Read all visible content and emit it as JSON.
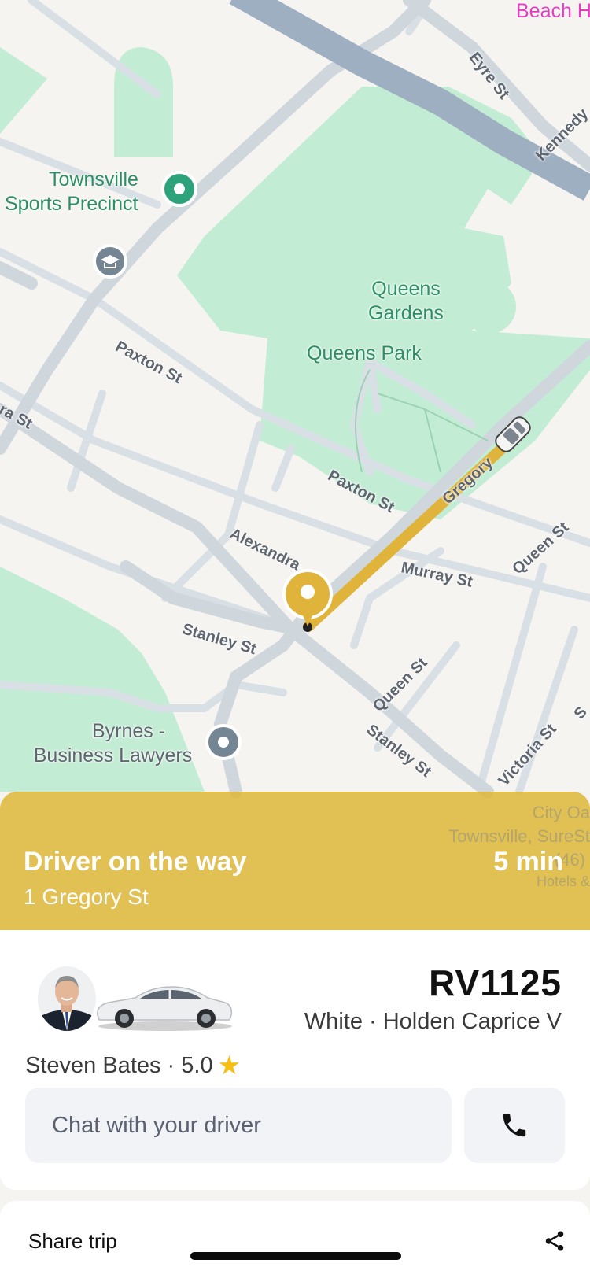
{
  "map": {
    "streets": {
      "eyre": "Eyre St",
      "kennedy": "Kennedy",
      "paxton_1": "Paxton St",
      "paxton_2": "Paxton St",
      "ra_st": "ra St",
      "alexandra": "Alexandra",
      "gregory": "Gregory",
      "murray": "Murray St",
      "queen_1": "Queen St",
      "queen_2": "Queen St",
      "stanley_1": "Stanley St",
      "stanley_2": "Stanley St",
      "victoria": "Victoria St",
      "s_edge": "S"
    },
    "pois": {
      "townsville_sports_line1": "Townsville",
      "townsville_sports_line2": "Sports Precinct",
      "queens_gardens_line1": "Queens",
      "queens_gardens_line2": "Gardens",
      "queens_park": "Queens Park",
      "byrnes_line1": "Byrnes -",
      "byrnes_line2": "Business Lawyers",
      "beach": "Beach H",
      "city_oaks_line1": "City Oa",
      "city_oaks_line2": "Townsville, SureSt",
      "city_oaks_line3": "(46)",
      "city_oaks_line4": "Hotels &"
    }
  },
  "status": {
    "title": "Driver on the way",
    "address": "1 Gregory St",
    "eta": "5 min"
  },
  "driver": {
    "plate": "RV1125",
    "vehicle": "White · Holden Caprice V",
    "name": "Steven Bates",
    "rating": "5.0",
    "name_rating": "Steven Bates · 5.0"
  },
  "chat": {
    "placeholder": "Chat with your driver"
  },
  "share": {
    "label": "Share trip"
  },
  "colors": {
    "accent": "#DEB83E",
    "route": "#E0B43A",
    "park": "#C3ECD4",
    "road": "#D5DCE1",
    "highway": "#9FAEC1",
    "star": "#F5BF16"
  },
  "icons": {
    "pin": "location-pin-icon",
    "car": "car-marker-icon",
    "phone": "phone-icon",
    "share": "share-icon",
    "star": "star-icon",
    "school": "school-icon"
  }
}
